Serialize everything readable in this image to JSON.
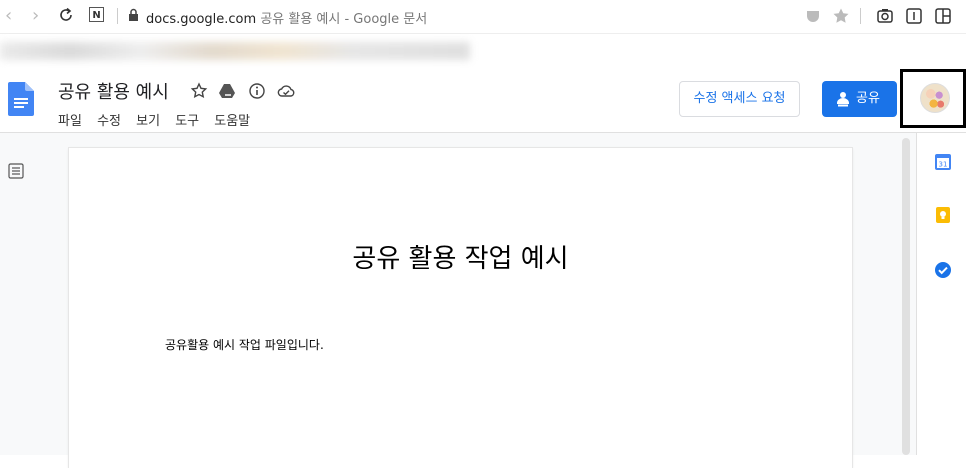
{
  "browser": {
    "url_domain": "docs.google.com",
    "url_rest": "공유 활용 예시 - Google 문서",
    "ext_label": "N"
  },
  "docs": {
    "title": "공유 활용 예시",
    "menu": [
      "파일",
      "수정",
      "보기",
      "도구",
      "도움말"
    ],
    "request_access_label": "수정 액세스 요청",
    "share_label": "공유",
    "accent_color": "#1a73e8"
  },
  "document": {
    "heading": "공유 활용 작업 예시",
    "body": "공유활용 예시 작업 파일입니다."
  },
  "side_panel": {
    "calendar_label": "31"
  }
}
